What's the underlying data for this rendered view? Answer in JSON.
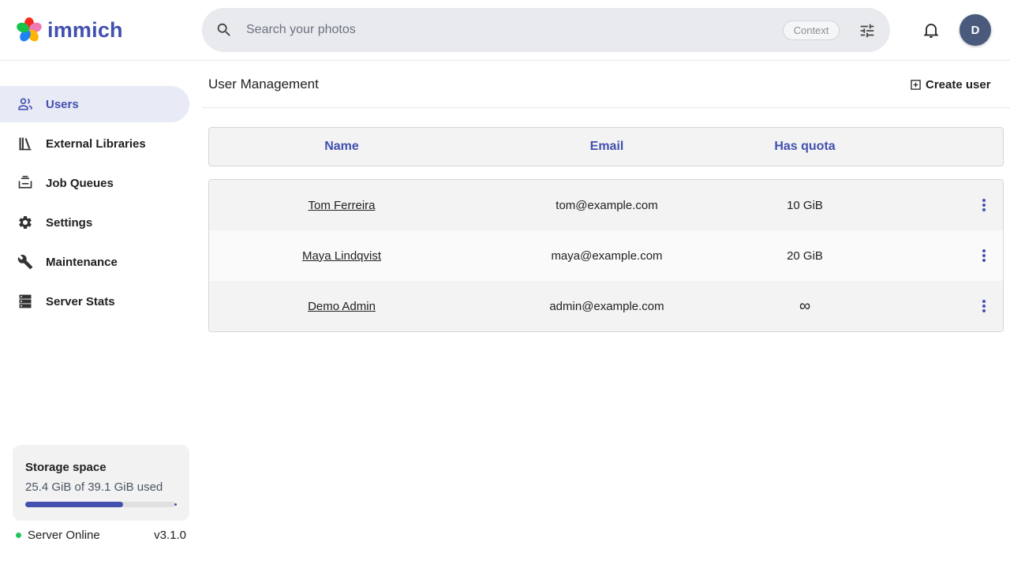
{
  "app": {
    "name": "immich",
    "brand_color": "#4250af"
  },
  "header": {
    "search_placeholder": "Search your photos",
    "context_label": "Context",
    "avatar_initial": "D",
    "icons": [
      "search-icon",
      "tune-icon",
      "bell-icon"
    ]
  },
  "sidebar": {
    "items": [
      {
        "label": "Users",
        "icon": "users-icon",
        "active": true
      },
      {
        "label": "External Libraries",
        "icon": "library-icon",
        "active": false
      },
      {
        "label": "Job Queues",
        "icon": "queue-icon",
        "active": false
      },
      {
        "label": "Settings",
        "icon": "gear-icon",
        "active": false
      },
      {
        "label": "Maintenance",
        "icon": "wrench-icon",
        "active": false
      },
      {
        "label": "Server Stats",
        "icon": "server-icon",
        "active": false
      }
    ],
    "storage": {
      "title": "Storage space",
      "usage_text": "25.4 GiB of 39.1 GiB used",
      "used_fraction": 0.65
    },
    "server_status": "Server Online",
    "status_color": "#22c55e",
    "version": "v3.1.0"
  },
  "main": {
    "title": "User Management",
    "create_user_label": "Create user",
    "table": {
      "columns": [
        "Name",
        "Email",
        "Has quota"
      ],
      "rows": [
        {
          "name": "Tom Ferreira",
          "email": "tom@example.com",
          "quota": "10 GiB"
        },
        {
          "name": "Maya Lindqvist",
          "email": "maya@example.com",
          "quota": "20 GiB"
        },
        {
          "name": "Demo Admin",
          "email": "admin@example.com",
          "quota": "∞"
        }
      ]
    }
  }
}
